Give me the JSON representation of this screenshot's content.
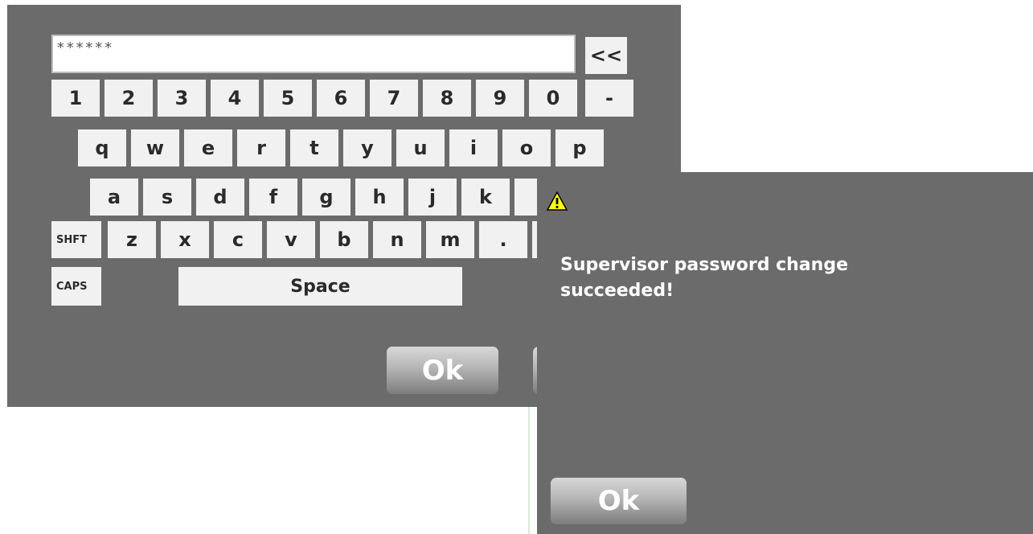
{
  "keyboard": {
    "password_value": "******",
    "backspace_label": "<<",
    "row1": [
      "1",
      "2",
      "3",
      "4",
      "5",
      "6",
      "7",
      "8",
      "9",
      "0",
      "-"
    ],
    "row2": [
      "q",
      "w",
      "e",
      "r",
      "t",
      "y",
      "u",
      "i",
      "o",
      "p"
    ],
    "row3": [
      "a",
      "s",
      "d",
      "f",
      "g",
      "h",
      "j",
      "k"
    ],
    "row4_shift": "SHFT",
    "row4": [
      "z",
      "x",
      "c",
      "v",
      "b",
      "n",
      "m",
      "."
    ],
    "caps_label": "CAPS",
    "space_label": "Space",
    "ok_label": "Ok"
  },
  "alert": {
    "icon": "warning-icon",
    "message_line1": "Supervisor password change",
    "message_line2": "succeeded!",
    "ok_label": "Ok"
  },
  "colors": {
    "panel": "#6b6b6b",
    "key": "#f1f1f1",
    "warning": "#ffff00"
  }
}
